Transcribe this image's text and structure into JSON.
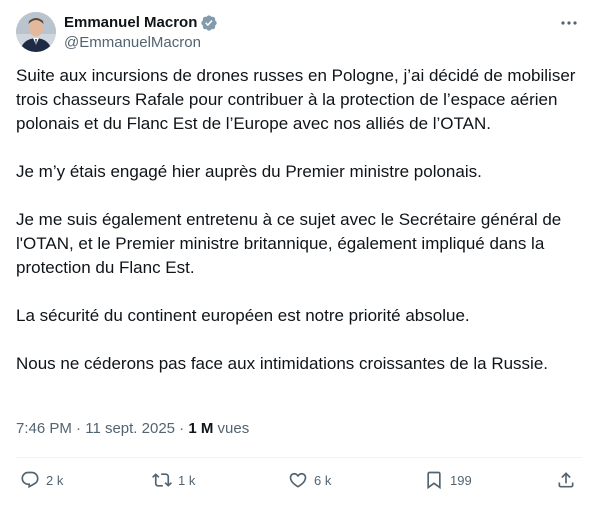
{
  "author": {
    "display_name": "Emmanuel Macron",
    "handle": "@EmmanuelMacron",
    "verified_icon": "verified-badge-icon",
    "avatar": "avatar"
  },
  "tweet": {
    "paragraphs": [
      "Suite aux incursions de drones russes en Pologne, j’ai décidé de mobiliser trois chasseurs Rafale pour contribuer à la protection de l’espace aérien polonais et du Flanc Est de l’Europe avec nos alliés de l’OTAN.",
      "Je m’y étais engagé hier auprès du Premier ministre polonais.",
      "Je me suis également entretenu à ce sujet avec le Secrétaire général de l'OTAN, et le Premier ministre britannique, également impliqué dans la protection du Flanc Est.",
      "La sécurité du continent européen est notre priorité absolue.",
      "Nous ne céderons pas face aux intimidations croissantes de la Russie."
    ],
    "time": "7:46 PM",
    "separator": " · ",
    "date": "11 sept. 2025",
    "views_count": "1 M",
    "views_label": " vues"
  },
  "actions": {
    "replies": "2 k",
    "reposts": "1 k",
    "likes": "6 k",
    "bookmarks": "199"
  },
  "colors": {
    "text": "#0f1419",
    "secondary": "#536471",
    "verified": "#829aab"
  }
}
